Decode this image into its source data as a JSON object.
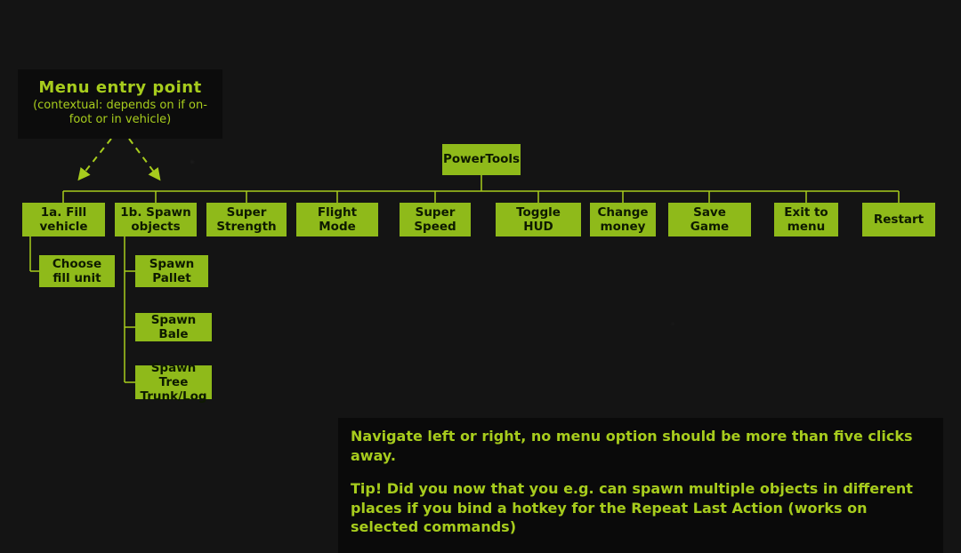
{
  "title": {
    "heading": "Menu entry point",
    "sub": "(contextual: depends on if on-foot or in vehicle)"
  },
  "root": {
    "label": "PowerTools"
  },
  "row": {
    "n0": "1a. Fill vehicle",
    "n1": "1b. Spawn objects",
    "n2": "Super Strength",
    "n3": "Flight Mode",
    "n4": "Super Speed",
    "n5": "Toggle HUD",
    "n6": "Change money",
    "n7": "Save Game",
    "n8": "Exit to menu",
    "n9": "Restart"
  },
  "fill_child": "Choose fill unit",
  "spawn_children": {
    "s0": "Spawn Pallet",
    "s1": "Spawn Bale",
    "s2": "Spawn Tree Trunk/Log"
  },
  "tips": {
    "p1": "Navigate left or right, no menu option should be more than five clicks away.",
    "p2": "Tip! Did you now that you e.g. can spawn multiple objects in different places if you bind a hotkey for the Repeat Last Action (works on selected commands)"
  },
  "colors": {
    "accent": "#a7cc1d",
    "node_bg": "#8fba1a",
    "bg": "#141414"
  }
}
